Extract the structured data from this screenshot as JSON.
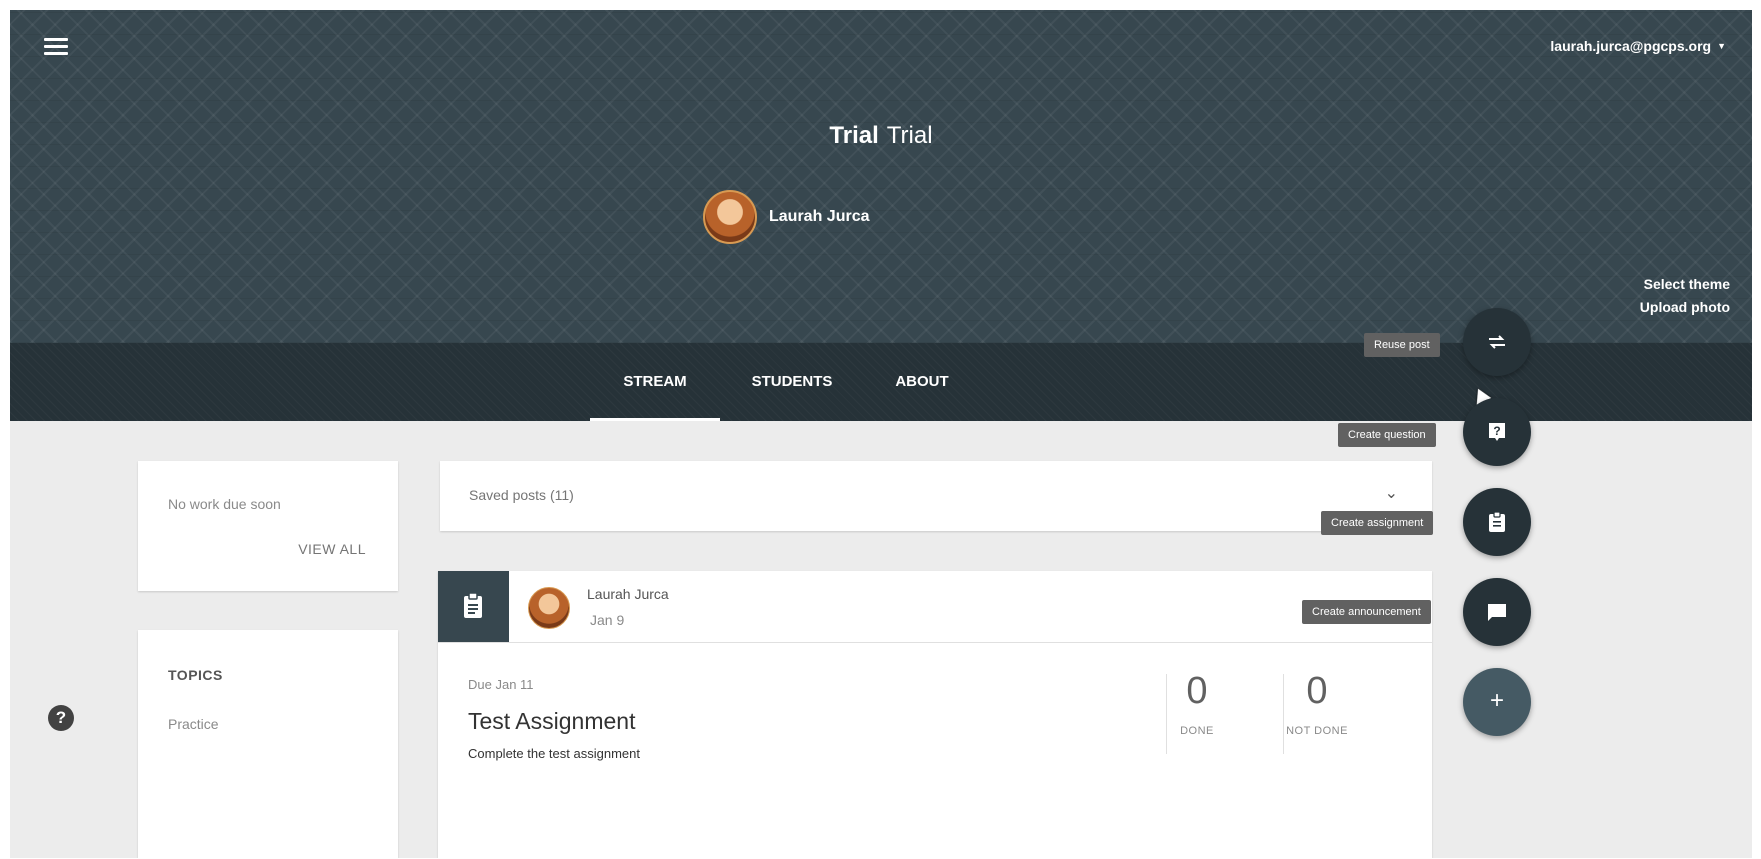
{
  "header": {
    "account_email": "laurah.jurca@pgcps.org",
    "class_name": "Trial",
    "class_section": "Trial",
    "teacher_name": "Laurah Jurca",
    "select_theme": "Select theme",
    "upload_photo": "Upload photo"
  },
  "tabs": [
    {
      "label": "STREAM",
      "active": true
    },
    {
      "label": "STUDENTS",
      "active": false
    },
    {
      "label": "ABOUT",
      "active": false
    }
  ],
  "upcoming": {
    "empty_text": "No work due soon",
    "view_all": "VIEW ALL"
  },
  "topics": {
    "heading": "TOPICS",
    "items": [
      "Practice"
    ]
  },
  "saved_posts": {
    "label": "Saved posts (11)"
  },
  "post": {
    "author": "Laurah Jurca",
    "date": "Jan 9",
    "due": "Due Jan 11",
    "title": "Test Assignment",
    "description": "Complete the test assignment",
    "done_count": "0",
    "done_label": "DONE",
    "not_done_count": "0",
    "not_done_label": "NOT DONE"
  },
  "fab_menu": {
    "reuse_post": "Reuse post",
    "create_question": "Create question",
    "create_assignment": "Create assignment",
    "create_announcement": "Create announcement",
    "main_icon": "plus-icon"
  },
  "colors": {
    "banner": "#37474f",
    "tabbar": "#263238",
    "fab": "#263238",
    "background": "#ececec"
  }
}
